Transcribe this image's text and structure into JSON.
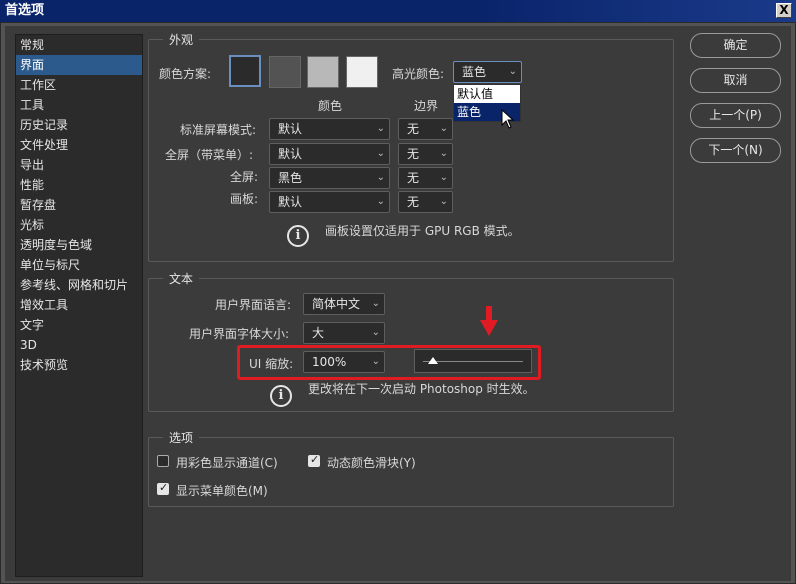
{
  "window": {
    "title": "首选项",
    "close_label": "X"
  },
  "sidebar": {
    "items": [
      {
        "label": "常规"
      },
      {
        "label": "界面"
      },
      {
        "label": "工作区"
      },
      {
        "label": "工具"
      },
      {
        "label": "历史记录"
      },
      {
        "label": "文件处理"
      },
      {
        "label": "导出"
      },
      {
        "label": "性能"
      },
      {
        "label": "暂存盘"
      },
      {
        "label": "光标"
      },
      {
        "label": "透明度与色域"
      },
      {
        "label": "单位与标尺"
      },
      {
        "label": "参考线、网格和切片"
      },
      {
        "label": "增效工具"
      },
      {
        "label": "文字"
      },
      {
        "label": "3D"
      },
      {
        "label": "技术预览"
      }
    ],
    "active": "界面"
  },
  "appearance": {
    "title": "外观",
    "color_scheme_label": "颜色方案:",
    "swatches": [
      "#2b2b2b",
      "#535353",
      "#b8b8b8",
      "#f0f0f0"
    ],
    "highlight_label": "高光颜色:",
    "highlight_value": "蓝色",
    "highlight_options": [
      "默认值",
      "蓝色"
    ],
    "col_color": "颜色",
    "col_border": "边界",
    "rows": [
      {
        "label": "标准屏幕模式:",
        "color": "默认",
        "border": "无"
      },
      {
        "label": "全屏（带菜单）:",
        "color": "默认",
        "border": "无"
      },
      {
        "label": "全屏:",
        "color": "黑色",
        "border": "无"
      },
      {
        "label": "画板:",
        "color": "默认",
        "border": "无"
      }
    ],
    "note": "画板设置仅适用于 GPU RGB 模式。"
  },
  "text": {
    "title": "文本",
    "ui_language_label": "用户界面语言:",
    "ui_language_value": "简体中文",
    "ui_font_size_label": "用户界面字体大小:",
    "ui_font_size_value": "大",
    "ui_scale_label": "UI 缩放:",
    "ui_scale_value": "100%",
    "ui_scale_slider": 0.1,
    "note": "更改将在下一次启动 Photoshop 时生效。"
  },
  "options": {
    "title": "选项",
    "items": [
      {
        "label": "用彩色显示通道(C)",
        "checked": false
      },
      {
        "label": "动态颜色滑块(Y)",
        "checked": true
      },
      {
        "label": "显示菜单颜色(M)",
        "checked": true
      }
    ]
  },
  "buttons": {
    "ok": "确定",
    "cancel": "取消",
    "prev": "上一个(P)",
    "next": "下一个(N)"
  },
  "colors": {
    "highlight": "#2d5a8c",
    "annotation": "#e01b24"
  }
}
